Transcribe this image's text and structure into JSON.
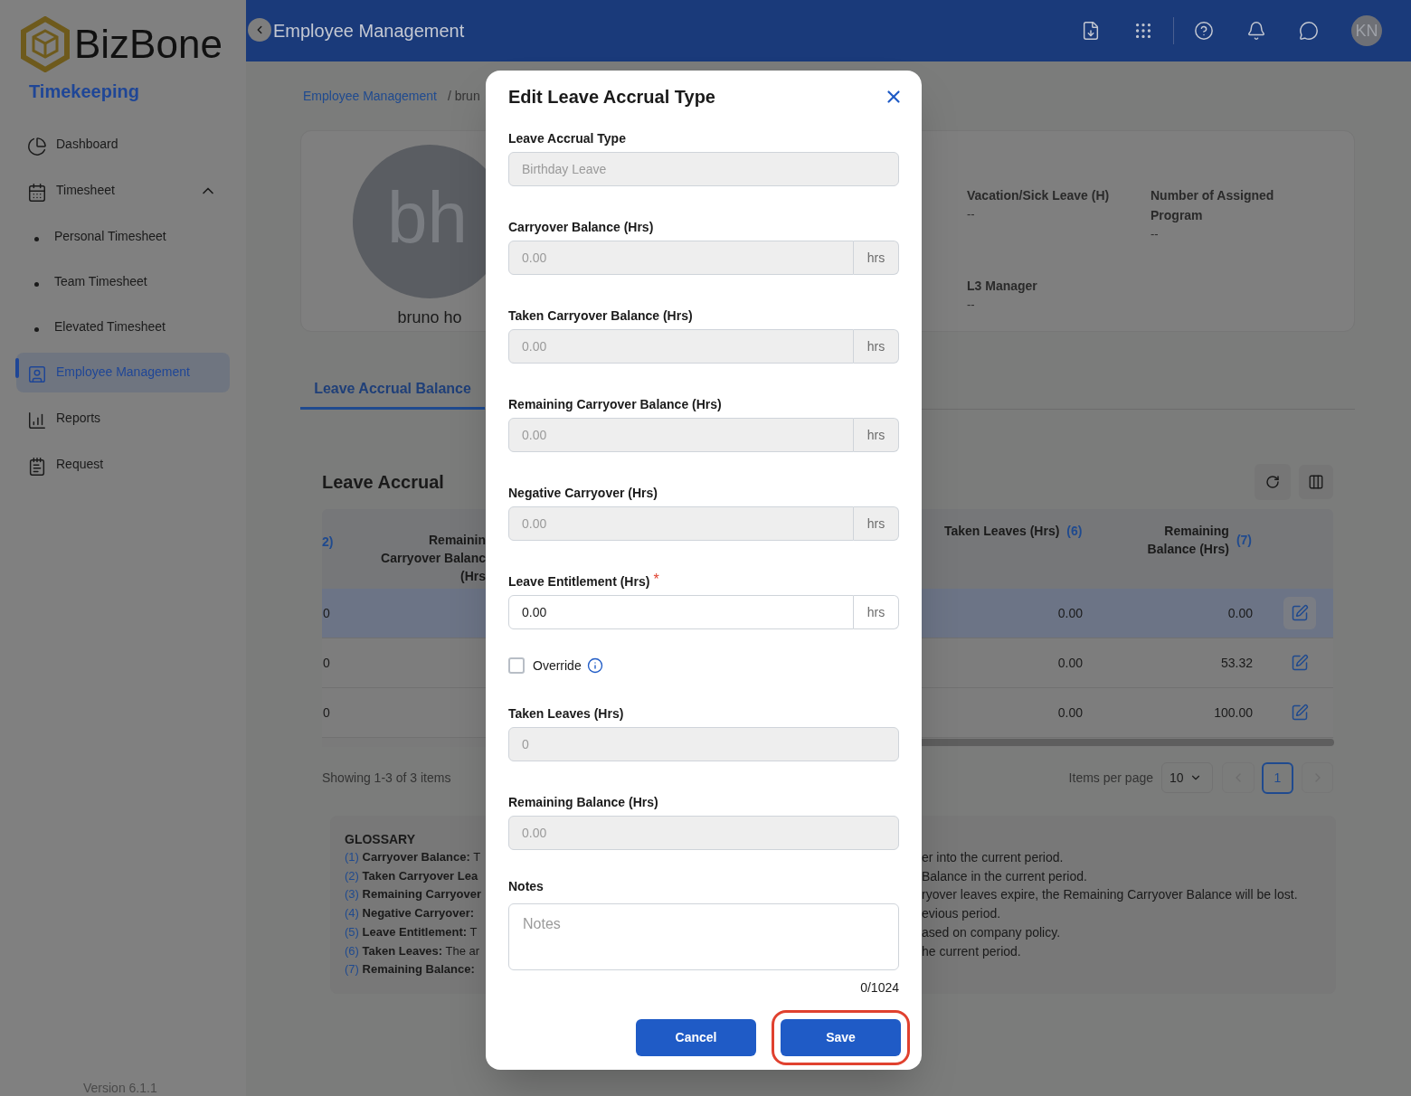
{
  "sidebar": {
    "brand": "BizBone",
    "product": "Timekeeping",
    "items": [
      {
        "label": "Dashboard",
        "selected": false
      },
      {
        "label": "Timesheet",
        "selected": false,
        "expanded": true,
        "children": [
          {
            "label": "Personal Timesheet",
            "selected": false
          },
          {
            "label": "Team Timesheet",
            "selected": false
          },
          {
            "label": "Elevated Timesheet",
            "selected": false
          }
        ]
      },
      {
        "label": "Employee Management",
        "selected": true
      },
      {
        "label": "Reports",
        "selected": false
      },
      {
        "label": "Request",
        "selected": false
      }
    ],
    "version": "Version 6.1.1"
  },
  "header": {
    "title": "Employee Management",
    "avatar": "KN"
  },
  "breadcrumb": {
    "link": "Employee Management",
    "current": "/ brun"
  },
  "profile": {
    "initials": "bh",
    "name": "bruno ho",
    "details": [
      {
        "label": "Vacation/Sick Leave (H)",
        "value": "--"
      },
      {
        "label": "Number of Assigned Program",
        "value": "--"
      },
      {
        "label": "L3 Manager",
        "value": "--"
      }
    ]
  },
  "tabs": [
    {
      "label": "Leave Accrual Balance",
      "selected": true
    }
  ],
  "leave_accrual": {
    "title": "Leave Accrual",
    "table": {
      "left_columns": [
        {
          "ref": "2)"
        },
        {
          "lines": [
            "Remainin",
            "Carryover Balanc",
            "(Hrs"
          ]
        }
      ],
      "right_columns": [
        {
          "label": "Taken Leaves (Hrs)",
          "ref": "(6)"
        },
        {
          "label": "Remaining Balance (Hrs)",
          "ref": "(7)"
        }
      ],
      "rows": [
        {
          "selected": true,
          "column_1": "0",
          "taken": "0.00",
          "remaining": "0.00"
        },
        {
          "selected": false,
          "column_1": "0",
          "taken": "0.00",
          "remaining": "53.32"
        },
        {
          "selected": false,
          "column_1": "0",
          "taken": "0.00",
          "remaining": "100.00"
        }
      ]
    },
    "summary": "Showing 1-3 of 3 items",
    "items_per_page_label": "Items per page",
    "items_per_page": "10",
    "pages": [
      {
        "label": "1",
        "selected": true
      }
    ]
  },
  "glossary": {
    "title": "GLOSSARY",
    "items": [
      {
        "number": "(1)",
        "term": "Carryover Balance:",
        "text": "T",
        "continued": "er into the current period."
      },
      {
        "number": "(2)",
        "term": "Taken Carryover Lea",
        "continued": "Balance in the current period."
      },
      {
        "number": "(3)",
        "term": "Remaining Carryover",
        "continued": "ryover leaves expire, the Remaining Carryover Balance will be lost."
      },
      {
        "number": "(4)",
        "term": "Negative Carryover:",
        "continued": "evious period."
      },
      {
        "number": "(5)",
        "term": "Leave Entitlement:",
        "text": "T",
        "continued": "ased on company policy."
      },
      {
        "number": "(6)",
        "term": "Taken Leaves:",
        "text": "The ar",
        "continued": "he current period."
      },
      {
        "number": "(7)",
        "term": "Remaining Balance:"
      }
    ]
  },
  "dialog": {
    "title": "Edit Leave Accrual Type",
    "fields": [
      {
        "kind": "text",
        "label": "Leave Accrual Type",
        "value": "Birthday Leave",
        "disabled": true
      },
      {
        "kind": "hours",
        "label": "Carryover Balance (Hrs)",
        "value": "0.00",
        "unit": "hrs",
        "disabled": true
      },
      {
        "kind": "hours",
        "label": "Taken Carryover Balance (Hrs)",
        "value": "0.00",
        "unit": "hrs",
        "disabled": true
      },
      {
        "kind": "hours",
        "label": "Remaining Carryover Balance (Hrs)",
        "value": "0.00",
        "unit": "hrs",
        "disabled": true
      },
      {
        "kind": "hours",
        "label": "Negative Carryover (Hrs)",
        "value": "0.00",
        "unit": "hrs",
        "disabled": true
      },
      {
        "kind": "hours",
        "label": "Leave Entitlement (Hrs)",
        "value": "0.00",
        "unit": "hrs",
        "disabled": false,
        "required_mark": "*"
      },
      {
        "kind": "checkbox",
        "label": "Override",
        "checked": false
      },
      {
        "kind": "text",
        "label": "Taken Leaves (Hrs)",
        "value": "0",
        "disabled": true
      },
      {
        "kind": "text",
        "label": "Remaining Balance (Hrs)",
        "value": "0.00",
        "disabled": true
      },
      {
        "kind": "textarea",
        "label": "Notes",
        "placeholder": "Notes",
        "counter": "0/1024"
      }
    ],
    "buttons": [
      {
        "label": "Cancel",
        "highlighted": false
      },
      {
        "label": "Save",
        "highlighted": true
      }
    ]
  }
}
